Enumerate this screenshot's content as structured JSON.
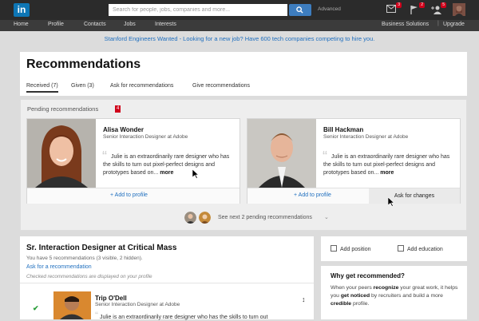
{
  "topbar": {
    "logo": "in",
    "search_placeholder": "Search for people, jobs, companies and more...",
    "advanced": "Advanced",
    "notifications": [
      {
        "icon": "messages-icon",
        "count": "3"
      },
      {
        "icon": "flag-icon",
        "count": "2"
      },
      {
        "icon": "add-connection-icon",
        "count": "5"
      }
    ]
  },
  "nav": {
    "items": [
      "Home",
      "Profile",
      "Contacts",
      "Jobs",
      "Interests"
    ],
    "business": "Business Solutions",
    "separator": "|",
    "upgrade": "Upgrade"
  },
  "banner": "Stanford Engineers Wanted - Looking for a new job? Have 600 tech companies competing to hire you.",
  "recommendations": {
    "title": "Recommendations",
    "tabs": [
      "Received (7)",
      "Given (3)",
      "Ask for recommendations",
      "Give recommendations"
    ],
    "active_tab": 0
  },
  "pending": {
    "title": "Pending recommendations",
    "count": "4",
    "cards": [
      {
        "name": "Alisa Wonder",
        "role": "Senior Interaction Designer at Adobe",
        "text": "Julie is an extraordinarily rare designer who has the skills to turn out pixel-perfect designs and prototypes based on...",
        "more": "more",
        "add_label": "+ Add to profile"
      },
      {
        "name": "Bill Hackman",
        "role": "Senior Interaction Designer at Adobe",
        "text": "Julie is an extraordinarily rare designer who has the skills to turn out pixel-perfect designs and prototypes based on...",
        "more": "more",
        "add_label": "+ Add to profile",
        "ask_label": "Ask for changes"
      }
    ],
    "see_next": "See next 2 pending recommendations"
  },
  "position": {
    "title": "Sr. Interaction Designer at Critical Mass",
    "summary": "You have 5 recommendations (3 visible, 2 hidden).",
    "ask_link": "Ask for a recommendation",
    "note": "Checked recommendations are displayed on your profile",
    "item": {
      "name": "Trip O'Dell",
      "role": "Senior Interaction Designer at Adobe",
      "text": "Julie is an extraordinarily rare designer who has the skills to turn out"
    }
  },
  "sidebar": {
    "add_position": "Add position",
    "add_education": "Add education",
    "why_title": "Why get recommended?",
    "why_text_1": "When your peers ",
    "why_bold_1": "recognize",
    "why_text_2": " your great work, it helps you ",
    "why_bold_2": "get noticed",
    "why_text_3": " by recruiters and build a more ",
    "why_bold_3": "credible",
    "why_text_4": " profile."
  },
  "colors": {
    "brand": "#0e76b5",
    "link": "#1f6fbf",
    "badge": "#d0021b",
    "topbar": "#2b2b2b"
  }
}
